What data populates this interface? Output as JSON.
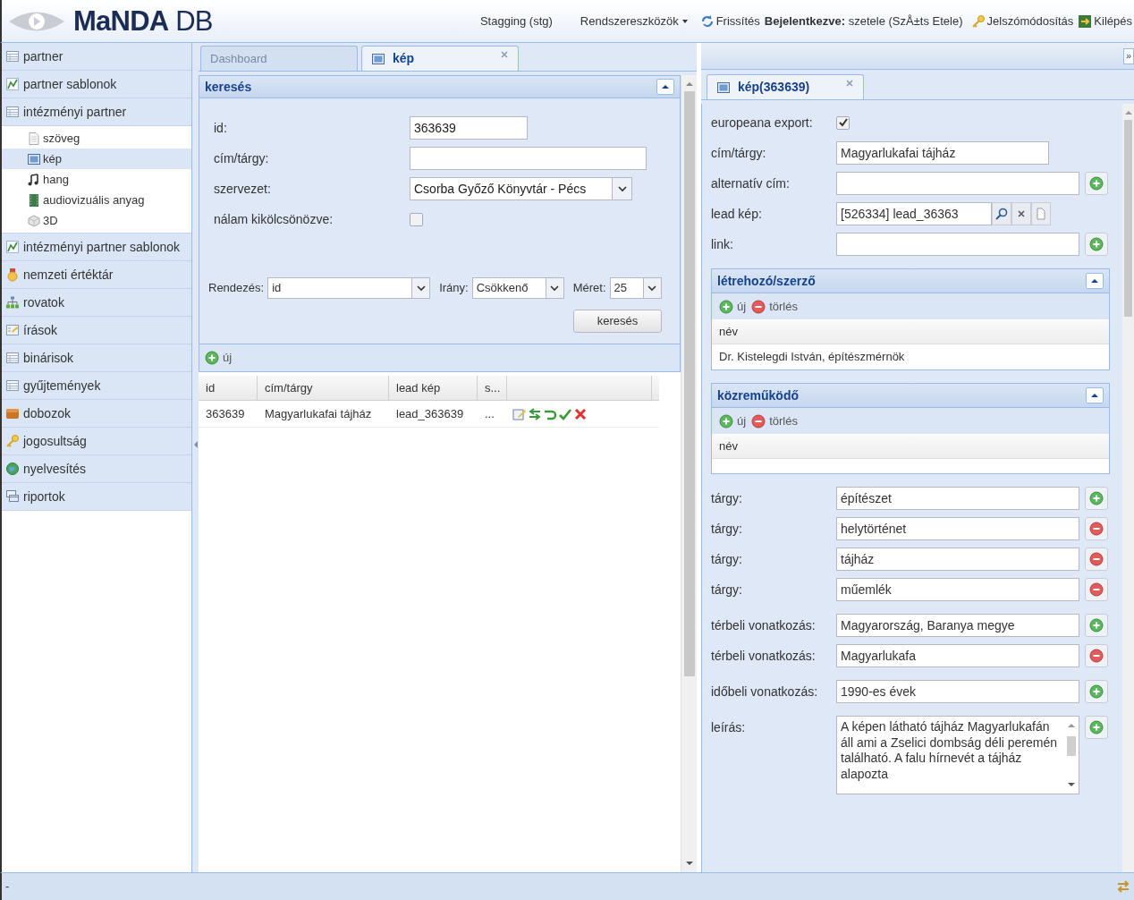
{
  "header": {
    "logo": "**MaNDA** DB",
    "environment": "Stagging (stg)",
    "menu": "Rendszereszközök",
    "refresh": "Frissítés",
    "login": "**Bejelentkezve:** szetele (SzÅ±ts Etele)",
    "password": "Jelszómódosítás",
    "logout": "Kilépés"
  },
  "sidebar": {
    "items": [
      {
        "label": "partner",
        "selected": false
      },
      {
        "label": "partner sablonok",
        "selected": false
      },
      {
        "label": "intézményi partner",
        "selected": false,
        "children": [
          {
            "label": "szöveg",
            "selected": false
          },
          {
            "label": "kép",
            "selected": true
          },
          {
            "label": "hang",
            "selected": false
          },
          {
            "label": "audiovizuális anyag",
            "selected": false
          },
          {
            "label": "3D",
            "selected": false
          }
        ]
      },
      {
        "label": "intézményi partner sablonok",
        "selected": false
      },
      {
        "label": "nemzeti értéktár",
        "selected": false
      },
      {
        "label": "rovatok",
        "selected": false
      },
      {
        "label": "írások",
        "selected": false
      },
      {
        "label": "binárisok",
        "selected": false
      },
      {
        "label": "gyűjtemények",
        "selected": false
      },
      {
        "label": "dobozok",
        "selected": false
      },
      {
        "label": "jogosultság",
        "selected": false
      },
      {
        "label": "nyelvesítés",
        "selected": false
      },
      {
        "label": "riportok",
        "selected": false
      }
    ]
  },
  "center": {
    "tabs": [
      {
        "label": "Dashboard",
        "selected": false,
        "closable": false
      },
      {
        "label": "kép",
        "selected": true,
        "closable": true
      }
    ],
    "search_panel": {
      "title": "keresés",
      "fields": [
        {
          "label": "id:",
          "kind": "number",
          "value": "363639"
        },
        {
          "label": "cím/tárgy:",
          "kind": "text"
        },
        {
          "label": "szervezet:",
          "kind": "select",
          "value": "Csorba Győző Könyvtár - Pécs"
        },
        {
          "label": "nálam kikölcsönözve:",
          "kind": "checkbox",
          "checked": false
        }
      ],
      "sort": {
        "label": "Rendezés:",
        "value": "id"
      },
      "direction": {
        "label": "Irány:",
        "value": "Csökkenő"
      },
      "size": {
        "label": "Méret:",
        "value": "25"
      },
      "button": "keresés"
    },
    "toolbar": {
      "new": "új"
    },
    "grid": {
      "columns": [
        "id",
        "cím/tárgy",
        "lead kép",
        "s..."
      ],
      "rows": [
        {
          "cells": [
            "363639",
            "Magyarlukafai tájház",
            "lead_363639",
            "..."
          ],
          "selected": false
        }
      ]
    }
  },
  "detail": {
    "collapse": "»",
    "tabs": [
      {
        "label": "kép(363639)",
        "selected": true,
        "closable": true
      }
    ],
    "groups": [
      {
        "kind": "fields",
        "fields": [
          {
            "label": "europeana export:",
            "kind": "checkbox",
            "checked": true
          },
          {
            "label": "cím/tárgy:",
            "kind": "text",
            "value": "Magyarlukafai tájház"
          },
          {
            "label": "alternatív cím:",
            "kind": "text",
            "add_button": true
          },
          {
            "label": "lead kép:",
            "kind": "lookup",
            "value": "[526334] lead_36363"
          },
          {
            "label": "link:",
            "kind": "text",
            "add_button": true
          }
        ]
      },
      {
        "kind": "section",
        "title": "létrehozó/szerző",
        "add": "új",
        "delete": "törlés",
        "column": "név",
        "rows": [
          "Dr. Kistelegdi István, építészmérnök"
        ]
      },
      {
        "kind": "section",
        "title": "közreműködő",
        "add": "új",
        "delete": "törlés",
        "column": "név"
      },
      {
        "kind": "fields",
        "fields": [
          {
            "label": "tárgy:",
            "kind": "text",
            "value": "építészet",
            "add_button": true
          },
          {
            "label": "tárgy:",
            "kind": "text",
            "value": "helytörténet",
            "remove_button": true
          },
          {
            "label": "tárgy:",
            "kind": "text",
            "value": "tájház",
            "remove_button": true
          },
          {
            "label": "tárgy:",
            "kind": "text",
            "value": "műemlék",
            "remove_button": true
          }
        ]
      },
      {
        "kind": "fields",
        "fields": [
          {
            "label": "térbeli vonatkozás:",
            "kind": "text",
            "value": "Magyarország, Baranya megye",
            "add_button": true
          },
          {
            "label": "térbeli vonatkozás:",
            "kind": "text",
            "value": "Magyarlukafa",
            "remove_button": true
          }
        ]
      },
      {
        "kind": "fields",
        "fields": [
          {
            "label": "időbeli vonatkozás:",
            "kind": "text",
            "value": "1990-es évek",
            "add_button": true
          }
        ]
      },
      {
        "kind": "fields",
        "fields": [
          {
            "label": "leírás:",
            "kind": "textarea",
            "value": "A képen látható tájház Magyarlukafán áll ami a Zselici dombság déli peremén található. A falu hírnevét a tájház alapozta",
            "add_button": true
          }
        ]
      }
    ]
  },
  "status_bar": {
    "text": "-"
  }
}
